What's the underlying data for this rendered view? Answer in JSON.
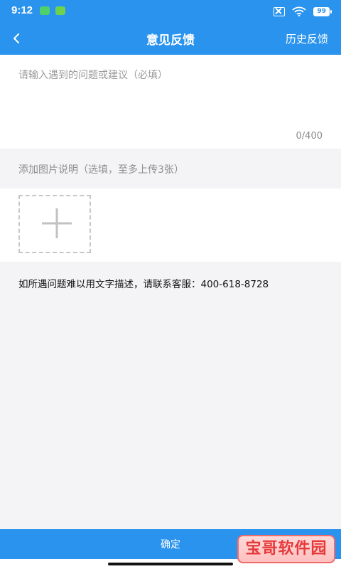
{
  "status_bar": {
    "time": "9:12",
    "battery": "99",
    "icons": [
      "wechat-icon",
      "message-icon",
      "sim-off-icon",
      "wifi-icon",
      "battery-icon"
    ]
  },
  "nav": {
    "title": "意见反馈",
    "action": "历史反馈",
    "back_icon": "chevron-left-icon"
  },
  "feedback": {
    "placeholder": "请输入遇到的问题或建议（必填）",
    "value": "",
    "counter": "0/400"
  },
  "images": {
    "label": "添加图片说明（选填，至多上传3张）",
    "add_icon": "plus-icon"
  },
  "contact": {
    "text": "如所遇问题难以用文字描述，请联系客服：400-618-8728"
  },
  "footer": {
    "confirm": "确定"
  },
  "watermark": {
    "text": "宝哥软件园"
  },
  "colors": {
    "primary": "#2a93ee",
    "background": "#f4f4f6",
    "surface": "#ffffff",
    "placeholder": "#9a9a9a"
  }
}
